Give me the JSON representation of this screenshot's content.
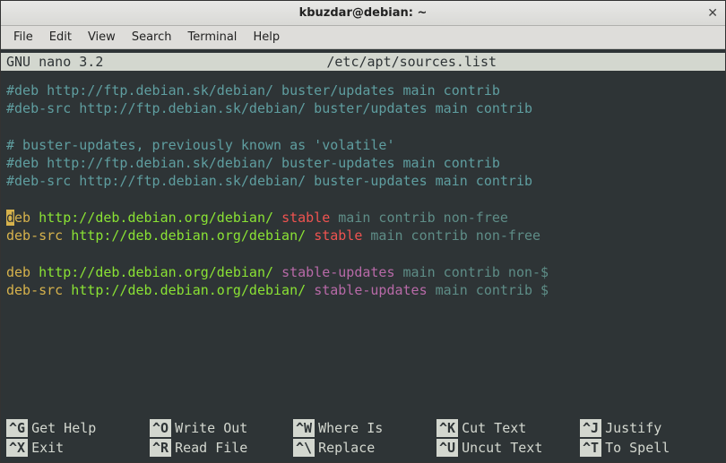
{
  "window": {
    "title": "kbuzdar@debian: ~",
    "close_glyph": "✕"
  },
  "menu": {
    "items": [
      "File",
      "Edit",
      "View",
      "Search",
      "Terminal",
      "Help"
    ]
  },
  "nano_header": {
    "app": "  GNU nano 3.2",
    "filename": "/etc/apt/sources.list"
  },
  "lines": [
    {
      "segments": [
        {
          "cls": "c-comment",
          "text": "#deb http://ftp.debian.sk/debian/ buster/updates main contrib"
        }
      ]
    },
    {
      "segments": [
        {
          "cls": "c-comment",
          "text": "#deb-src http://ftp.debian.sk/debian/ buster/updates main contrib"
        }
      ]
    },
    {
      "segments": [
        {
          "cls": "",
          "text": ""
        }
      ]
    },
    {
      "segments": [
        {
          "cls": "c-comment",
          "text": "# buster-updates, previously known as 'volatile'"
        }
      ]
    },
    {
      "segments": [
        {
          "cls": "c-comment",
          "text": "#deb http://ftp.debian.sk/debian/ buster-updates main contrib"
        }
      ]
    },
    {
      "segments": [
        {
          "cls": "c-comment",
          "text": "#deb-src http://ftp.debian.sk/debian/ buster-updates main contrib"
        }
      ]
    },
    {
      "segments": [
        {
          "cls": "",
          "text": ""
        }
      ]
    },
    {
      "segments": [
        {
          "cls": "inv-cursor",
          "text": "d"
        },
        {
          "cls": "c-deb",
          "text": "eb "
        },
        {
          "cls": "c-url",
          "text": "http://deb.debian.org/debian/ "
        },
        {
          "cls": "c-suite",
          "text": "stable "
        },
        {
          "cls": "c-comp",
          "text": "main contrib non-free"
        }
      ]
    },
    {
      "segments": [
        {
          "cls": "c-deb",
          "text": "deb-src "
        },
        {
          "cls": "c-url",
          "text": "http://deb.debian.org/debian/ "
        },
        {
          "cls": "c-suite",
          "text": "stable "
        },
        {
          "cls": "c-comp",
          "text": "main contrib non-free"
        }
      ]
    },
    {
      "segments": [
        {
          "cls": "",
          "text": ""
        }
      ]
    },
    {
      "segments": [
        {
          "cls": "c-deb",
          "text": "deb "
        },
        {
          "cls": "c-url",
          "text": "http://deb.debian.org/debian/ "
        },
        {
          "cls": "c-suite2",
          "text": "stable-updates "
        },
        {
          "cls": "c-comp",
          "text": "main contrib non-$"
        }
      ]
    },
    {
      "segments": [
        {
          "cls": "c-deb",
          "text": "deb-src "
        },
        {
          "cls": "c-url",
          "text": "http://deb.debian.org/debian/ "
        },
        {
          "cls": "c-suite2",
          "text": "stable-updates "
        },
        {
          "cls": "c-comp",
          "text": "main contrib $"
        }
      ]
    }
  ],
  "shortcuts": {
    "rows": [
      [
        {
          "key": "^G",
          "label": "Get Help"
        },
        {
          "key": "^O",
          "label": "Write Out"
        },
        {
          "key": "^W",
          "label": "Where Is"
        },
        {
          "key": "^K",
          "label": "Cut Text"
        },
        {
          "key": "^J",
          "label": "Justify"
        }
      ],
      [
        {
          "key": "^X",
          "label": "Exit"
        },
        {
          "key": "^R",
          "label": "Read File"
        },
        {
          "key": "^\\",
          "label": "Replace"
        },
        {
          "key": "^U",
          "label": "Uncut Text"
        },
        {
          "key": "^T",
          "label": "To Spell"
        }
      ]
    ]
  }
}
